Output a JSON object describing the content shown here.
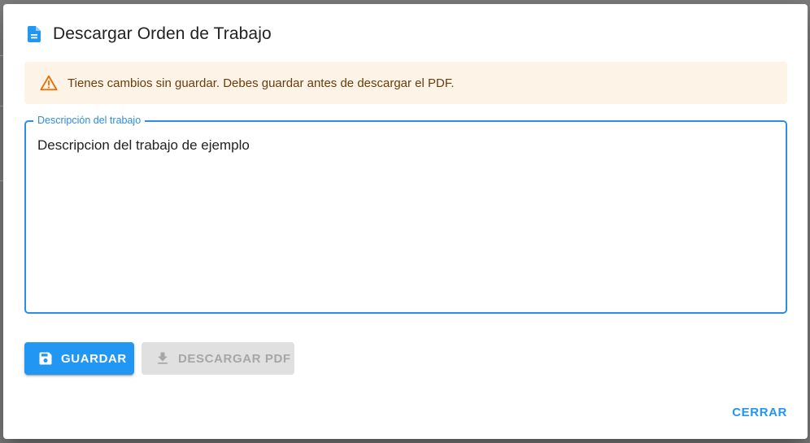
{
  "dialog": {
    "title": "Descargar Orden de Trabajo",
    "title_icon": "document-icon"
  },
  "alert": {
    "message": "Tienes cambios sin guardar. Debes guardar antes de descargar el PDF.",
    "icon": "warning-icon",
    "background": "#fdf3e7",
    "text_color": "#6b3c0b",
    "icon_color": "#ed6c02"
  },
  "description_field": {
    "label": "Descripción del trabajo",
    "value": "Descripcion del trabajo de ejemplo",
    "accent": "#2c8de3"
  },
  "actions": {
    "save_label": "GUARDAR",
    "save_icon": "floppy-disk-icon",
    "download_label": "DESCARGAR PDF",
    "download_icon": "download-icon",
    "download_disabled": true,
    "close_label": "CERRAR",
    "primary_color": "#2196f3"
  }
}
